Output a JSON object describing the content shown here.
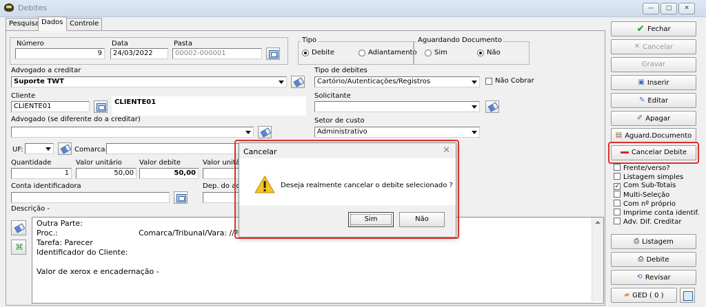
{
  "window": {
    "title": "Debites",
    "min": "—",
    "max": "□",
    "close": "✕"
  },
  "tabs": [
    "Pesquisa",
    "Dados",
    "Controle"
  ],
  "fields": {
    "numero_label": "Número",
    "numero_value": "9",
    "data_label": "Data",
    "data_value": "24/03/2022",
    "pasta_label": "Pasta",
    "pasta_value": "00002-000001",
    "tipo_label": "Tipo",
    "tipo_opt1": "Debite",
    "tipo_opt2": "Adiantamento",
    "aguardando_label": "Aguardando Documento",
    "ag_opt1": "Sim",
    "ag_opt2": "Não",
    "advogado_label": "Advogado a creditar",
    "advogado_value": "Suporte TWT",
    "tipo_debites_label": "Tipo de debites",
    "tipo_debites_value": "Cartório/Autenticações/Registros",
    "nao_cobrar": "Não Cobrar",
    "cliente_label": "Cliente",
    "cliente_code": "CLIENTE01",
    "cliente_name": "CLIENTE01",
    "solicitante_label": "Solicitante",
    "advogado2_label": "Advogado  (se diferente do a creditar)",
    "setor_label": "Setor de custo",
    "setor_value": "Administrativo",
    "uf_label": "UF:",
    "comarca_label": "Comarca:",
    "quantidade_label": "Quantidade",
    "quantidade_value": "1",
    "valor_unit_label": "Valor unitário",
    "valor_unit_value": "50,00",
    "valor_debite_label": "Valor debite",
    "valor_debite_value": "50,00",
    "valor_unit2_label": "Valor unitário",
    "conta_label": "Conta identificadora",
    "dep_label": "Dep. do adia",
    "descricao_label": "Descrição  -"
  },
  "memo": {
    "l1": "Outra Parte:",
    "l2": "Proc.:",
    "l2b": "Comarca/Tribunal/Vara: //ª",
    "l3": "Tarefa: Parecer",
    "l4": "Identificador do Cliente:",
    "l5": "Valor de xerox e encadernação -"
  },
  "actions": {
    "fechar": "Fechar",
    "cancelar": "Cancelar",
    "gravar": "Gravar",
    "inserir": "Inserir",
    "editar": "Editar",
    "apagar": "Apagar",
    "aguard": "Aguard.Documento",
    "cancelar_debite": "Cancelar Debite",
    "listagem": "Listagem",
    "debite": "Debite",
    "revisar": "Revisar",
    "ged": "GED ( 0 )"
  },
  "options": {
    "o1": "Frente/verso?",
    "o2": "Listagem simples",
    "o3": "Com Sub-Totais",
    "o4": "Multi-Seleção",
    "o5": "Com nº próprio",
    "o6": "Imprime conta identif.",
    "o7": "Adv. Dif. Creditar",
    "check": "✓"
  },
  "dialog": {
    "title": "Cancelar",
    "close": "✕",
    "message": "Deseja realmente cancelar o debite selecionado ?",
    "yes": "Sim",
    "no": "Não"
  },
  "colors": {
    "highlight": "#d9302a"
  }
}
